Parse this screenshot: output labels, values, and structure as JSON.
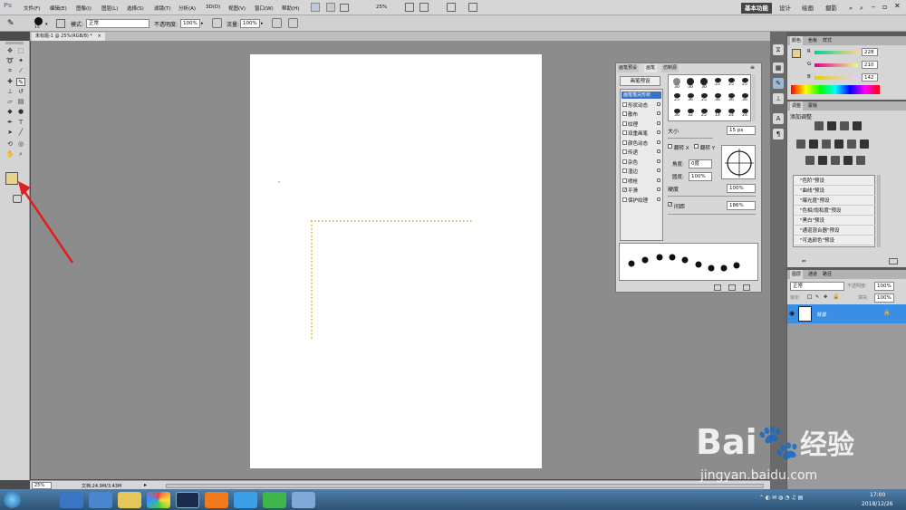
{
  "app": {
    "logo": "Ps"
  },
  "menu": [
    "文件(F)",
    "编辑(E)",
    "图像(I)",
    "图层(L)",
    "选择(S)",
    "滤镜(T)",
    "分析(A)",
    "3D(D)",
    "视图(V)",
    "窗口(W)",
    "帮助(H)"
  ],
  "zoom_menu": "25%",
  "workspaces": [
    "基本功能",
    "设计",
    "绘画",
    "摄影"
  ],
  "workspace_more": "»",
  "options": {
    "brush_size": "15",
    "mode_label": "模式:",
    "mode_value": "正常",
    "opacity_label": "不透明度:",
    "opacity_value": "100%",
    "flow_label": "流量:",
    "flow_value": "100%"
  },
  "document": {
    "tab_title": "未标题-1 @ 25%(RGB/8) *",
    "close": "×"
  },
  "status": {
    "zoom": "25%",
    "doc_info": "文档:24.9M/3.43M"
  },
  "brush_panel": {
    "tabs": [
      "画笔预设",
      "画笔",
      "仿制源"
    ],
    "preset_button": "画笔预设",
    "tip_row1": [
      "30",
      "30",
      "30",
      "25",
      "25",
      "25"
    ],
    "tip_row2": [
      "25",
      "36",
      "25",
      "36",
      "36",
      "36"
    ],
    "tip_row3": [
      "36",
      "32",
      "25",
      "14",
      "24",
      "24"
    ],
    "items": [
      "画笔笔尖形状",
      "形状动态",
      "散布",
      "纹理",
      "双重画笔",
      "颜色动态",
      "传递",
      "杂色",
      "湿边",
      "喷枪",
      "平滑",
      "保护纹理"
    ],
    "checked": [
      false,
      false,
      false,
      false,
      false,
      false,
      false,
      false,
      false,
      false,
      true,
      false
    ],
    "size_label": "大小",
    "size_value": "15 px",
    "flipx_label": "翻转 X",
    "flipy_label": "翻转 Y",
    "angle_label": "角度:",
    "angle_value": "0度",
    "roundness_label": "圆度:",
    "roundness_value": "100%",
    "hardness_label": "硬度",
    "hardness_value": "100%",
    "spacing_label": "间距",
    "spacing_value": "186%"
  },
  "color_panel": {
    "tabs": [
      "颜色",
      "色板",
      "样式"
    ],
    "r_label": "R",
    "r_value": "228",
    "g_label": "G",
    "g_value": "210",
    "b_label": "B",
    "b_value": "142",
    "foreground": "#e4d28e"
  },
  "adjust_panel": {
    "tabs": [
      "调整",
      "蒙版"
    ],
    "title": "添加调整",
    "presets": [
      "\"色阶\"预设",
      "\"曲线\"预设",
      "\"曝光度\"预设",
      "\"色相/饱和度\"预设",
      "\"黑白\"预设",
      "\"通道混合器\"预设",
      "\"可选颜色\"预设"
    ]
  },
  "layers_panel": {
    "tabs": [
      "图层",
      "通道",
      "路径"
    ],
    "mode": "正常",
    "opacity_label": "不透明度:",
    "opacity_value": "100%",
    "lock_label": "锁定:",
    "fill_label": "填充:",
    "fill_value": "100%",
    "layer_name": "背景"
  },
  "taskbar": {
    "time": "17:00",
    "date": "2018/12/26"
  },
  "watermark": {
    "brand": "Bai",
    "brand2": "经验",
    "url": "jingyan.baidu.com"
  },
  "colors": {
    "accent": "#3a8ee6",
    "arrow": "#e02020",
    "dots": "#d8c25a"
  }
}
